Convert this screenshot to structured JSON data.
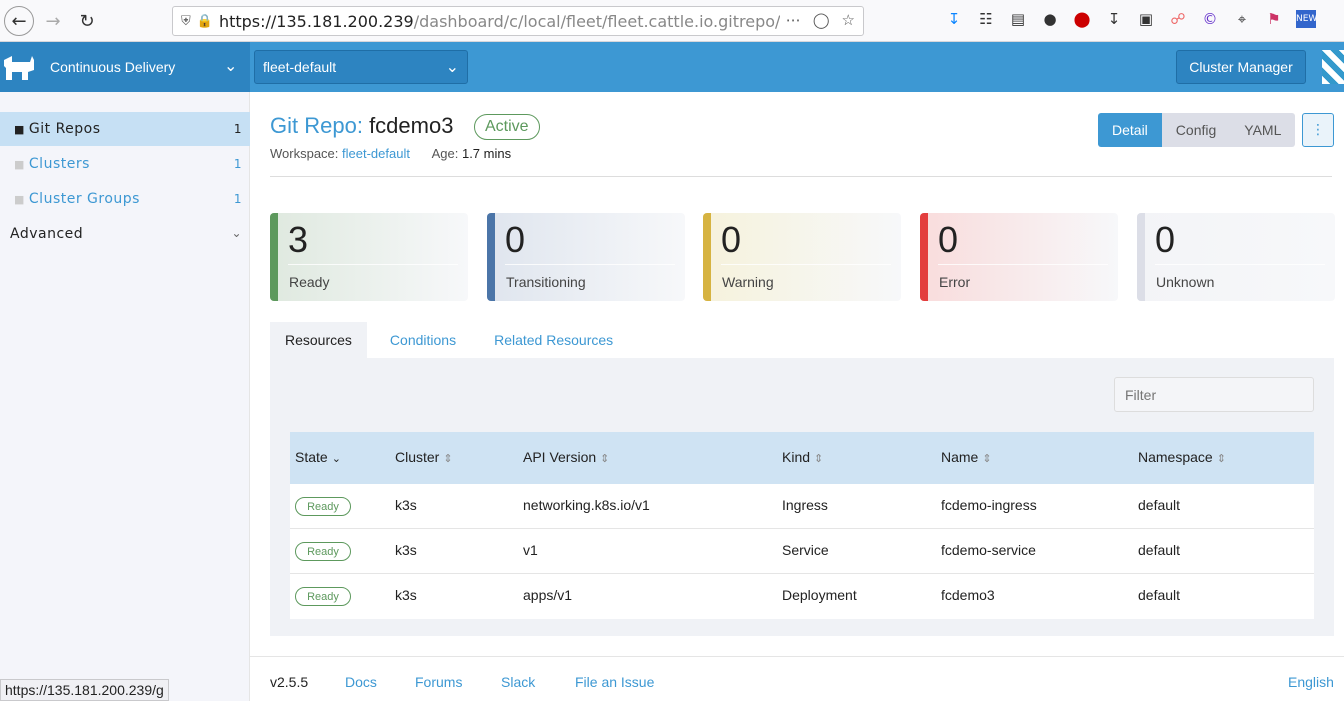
{
  "browser": {
    "url_host": "https://135.181.200.239",
    "url_path": "/dashboard/c/local/fleet/fleet.cattle.io.gitrepo/fl",
    "status_url": "https://135.181.200.239/g",
    "new_badge": "NEW"
  },
  "header": {
    "product": "Continuous Delivery",
    "workspace_select": "fleet-default",
    "cluster_manager": "Cluster Manager"
  },
  "sidebar": {
    "items": [
      {
        "label": "Git Repos",
        "count": "1"
      },
      {
        "label": "Clusters",
        "count": "1"
      },
      {
        "label": "Cluster Groups",
        "count": "1"
      }
    ],
    "advanced": "Advanced"
  },
  "page": {
    "title_prefix": "Git Repo:",
    "title_name": "fcdemo3",
    "status": "Active",
    "workspace_label": "Workspace:",
    "workspace_value": "fleet-default",
    "age_label": "Age:",
    "age_value": "1.7 mins",
    "views": [
      "Detail",
      "Config",
      "YAML"
    ],
    "more": "⋮"
  },
  "stats": [
    {
      "value": "3",
      "label": "Ready",
      "color": "#5d995d",
      "bg": "#dfe9df"
    },
    {
      "value": "0",
      "label": "Transitioning",
      "color": "#4b75a8",
      "bg": "#dfe5ee"
    },
    {
      "value": "0",
      "label": "Warning",
      "color": "#d6b341",
      "bg": "#f6f2dc"
    },
    {
      "value": "0",
      "label": "Error",
      "color": "#e33e3e",
      "bg": "#f9dcdc"
    },
    {
      "value": "0",
      "label": "Unknown",
      "color": "#dcdee7",
      "bg": "#f3f4f7"
    }
  ],
  "tabs": [
    "Resources",
    "Conditions",
    "Related Resources"
  ],
  "filter_placeholder": "Filter",
  "table": {
    "headers": [
      "State",
      "Cluster",
      "API Version",
      "Kind",
      "Name",
      "Namespace"
    ],
    "rows": [
      {
        "state": "Ready",
        "cluster": "k3s",
        "api": "networking.k8s.io/v1",
        "kind": "Ingress",
        "name": "fcdemo-ingress",
        "namespace": "default"
      },
      {
        "state": "Ready",
        "cluster": "k3s",
        "api": "v1",
        "kind": "Service",
        "name": "fcdemo-service",
        "namespace": "default"
      },
      {
        "state": "Ready",
        "cluster": "k3s",
        "api": "apps/v1",
        "kind": "Deployment",
        "name": "fcdemo3",
        "namespace": "default"
      }
    ]
  },
  "footer": {
    "version": "v2.5.5",
    "links": [
      "Docs",
      "Forums",
      "Slack",
      "File an Issue"
    ],
    "language": "English"
  }
}
